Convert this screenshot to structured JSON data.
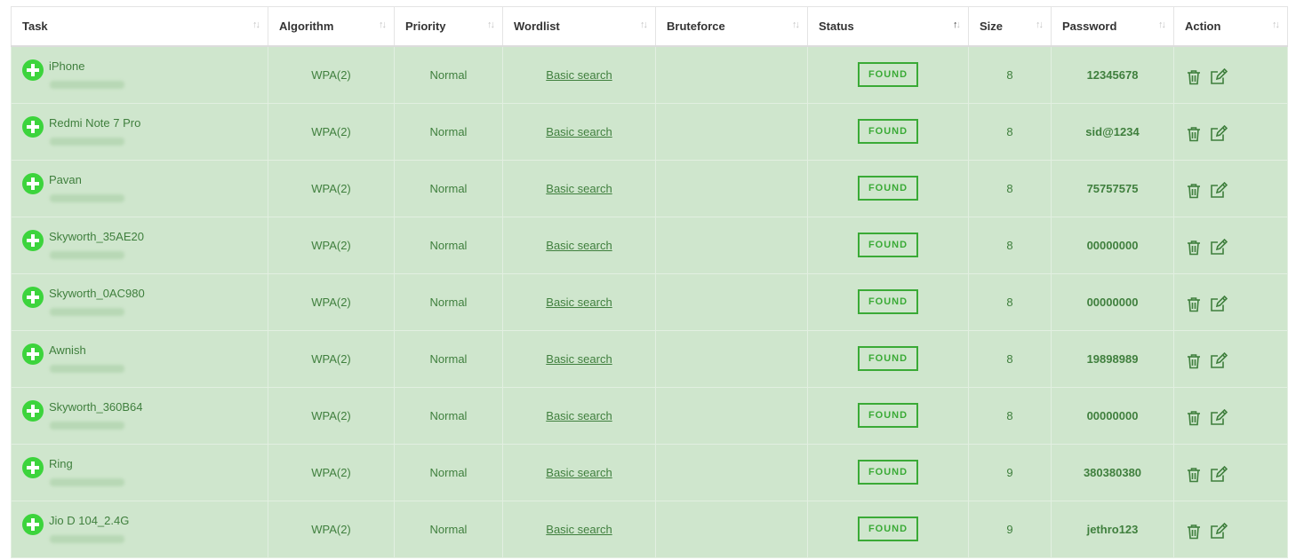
{
  "table": {
    "columns": [
      {
        "label": "Task",
        "sort": "none"
      },
      {
        "label": "Algorithm",
        "sort": "none"
      },
      {
        "label": "Priority",
        "sort": "none"
      },
      {
        "label": "Wordlist",
        "sort": "none"
      },
      {
        "label": "Bruteforce",
        "sort": "none"
      },
      {
        "label": "Status",
        "sort": "asc"
      },
      {
        "label": "Size",
        "sort": "none"
      },
      {
        "label": "Password",
        "sort": "none"
      },
      {
        "label": "Action",
        "sort": "none"
      }
    ],
    "rows": [
      {
        "task": "iPhone",
        "algorithm": "WPA(2)",
        "priority": "Normal",
        "wordlist": "Basic search",
        "bruteforce": "",
        "status": "FOUND",
        "size": "8",
        "password": "12345678"
      },
      {
        "task": "Redmi Note 7 Pro",
        "algorithm": "WPA(2)",
        "priority": "Normal",
        "wordlist": "Basic search",
        "bruteforce": "",
        "status": "FOUND",
        "size": "8",
        "password": "sid@1234"
      },
      {
        "task": "Pavan",
        "algorithm": "WPA(2)",
        "priority": "Normal",
        "wordlist": "Basic search",
        "bruteforce": "",
        "status": "FOUND",
        "size": "8",
        "password": "75757575"
      },
      {
        "task": "Skyworth_35AE20",
        "algorithm": "WPA(2)",
        "priority": "Normal",
        "wordlist": "Basic search",
        "bruteforce": "",
        "status": "FOUND",
        "size": "8",
        "password": "00000000"
      },
      {
        "task": "Skyworth_0AC980",
        "algorithm": "WPA(2)",
        "priority": "Normal",
        "wordlist": "Basic search",
        "bruteforce": "",
        "status": "FOUND",
        "size": "8",
        "password": "00000000"
      },
      {
        "task": "Awnish",
        "algorithm": "WPA(2)",
        "priority": "Normal",
        "wordlist": "Basic search",
        "bruteforce": "",
        "status": "FOUND",
        "size": "8",
        "password": "19898989"
      },
      {
        "task": "Skyworth_360B64",
        "algorithm": "WPA(2)",
        "priority": "Normal",
        "wordlist": "Basic search",
        "bruteforce": "",
        "status": "FOUND",
        "size": "8",
        "password": "00000000"
      },
      {
        "task": "Ring",
        "algorithm": "WPA(2)",
        "priority": "Normal",
        "wordlist": "Basic search",
        "bruteforce": "",
        "status": "FOUND",
        "size": "9",
        "password": "380380380"
      },
      {
        "task": "Jio D 104_2.4G",
        "algorithm": "WPA(2)",
        "priority": "Normal",
        "wordlist": "Basic search",
        "bruteforce": "",
        "status": "FOUND",
        "size": "9",
        "password": "jethro123"
      }
    ],
    "row_actions": [
      "trash-icon",
      "edit-icon"
    ]
  },
  "colors": {
    "row_background": "#cfe6cd",
    "text_green": "#3f7f3d",
    "badge_green": "#3aaa36",
    "add_icon_green": "#3cd43c",
    "header_background": "#ffffff"
  }
}
